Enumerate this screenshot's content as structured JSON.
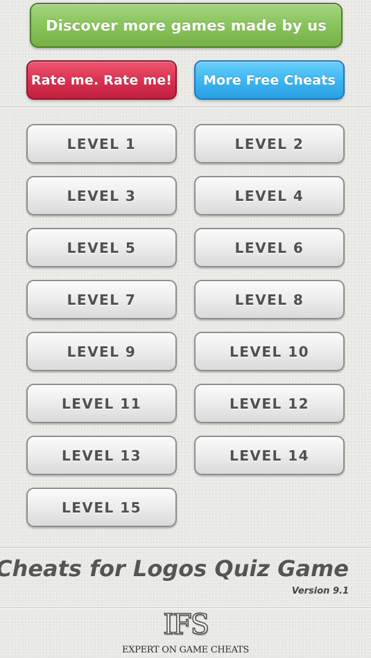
{
  "header": {
    "discover_label": "Discover more games made by us",
    "rate_label": "Rate me. Rate me!",
    "more_cheats_label": "More Free Cheats"
  },
  "levels": [
    "LEVEL 1",
    "LEVEL 2",
    "LEVEL 3",
    "LEVEL 4",
    "LEVEL 5",
    "LEVEL 6",
    "LEVEL 7",
    "LEVEL 8",
    "LEVEL 9",
    "LEVEL 10",
    "LEVEL 11",
    "LEVEL 12",
    "LEVEL 13",
    "LEVEL 14",
    "LEVEL 15"
  ],
  "footer": {
    "app_title": "Cheats for Logos Quiz Game",
    "version": "Version 9.1",
    "logo_mark": "IFS",
    "logo_tagline": "EXPERT ON GAME CHEATS"
  },
  "colors": {
    "green_button": "#89c45b",
    "red_button": "#d7304f",
    "blue_button": "#3ab4f0",
    "level_button": "#ececec",
    "level_text": "#505050",
    "background": "#e9e9e6"
  }
}
